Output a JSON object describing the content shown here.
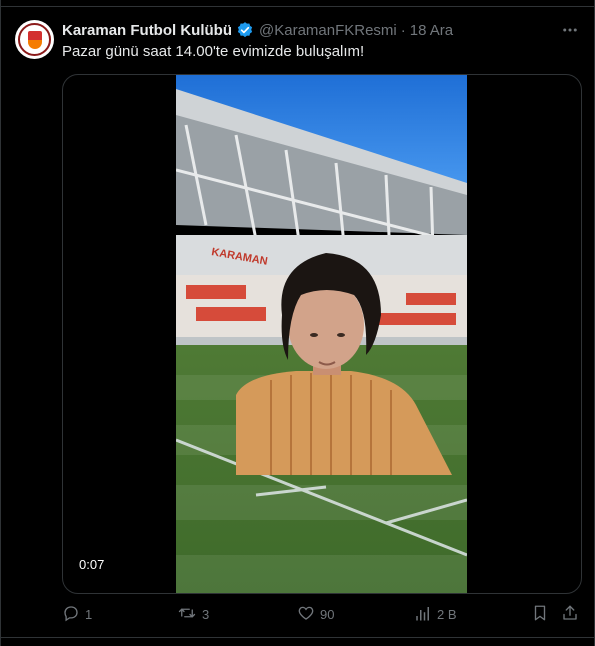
{
  "tweet": {
    "display_name": "Karaman Futbol Kulübü",
    "handle": "@KaramanFKResmi",
    "separator": "·",
    "time": "18 Ara",
    "text": "Pazar günü saat 14.00'te evimizde buluşalım!"
  },
  "media": {
    "duration": "0:07",
    "stadium_sign": "KARAMAN"
  },
  "actions": {
    "replies": "1",
    "retweets": "3",
    "likes": "90",
    "views": "2 B"
  },
  "colors": {
    "background": "#000000",
    "text": "#e7e9ea",
    "muted": "#71767b",
    "verified": "#1d9bf0",
    "border": "#2f3336"
  },
  "icons": [
    "more-icon",
    "verified-badge-icon",
    "reply-icon",
    "retweet-icon",
    "like-icon",
    "views-icon",
    "bookmark-icon",
    "share-icon"
  ]
}
